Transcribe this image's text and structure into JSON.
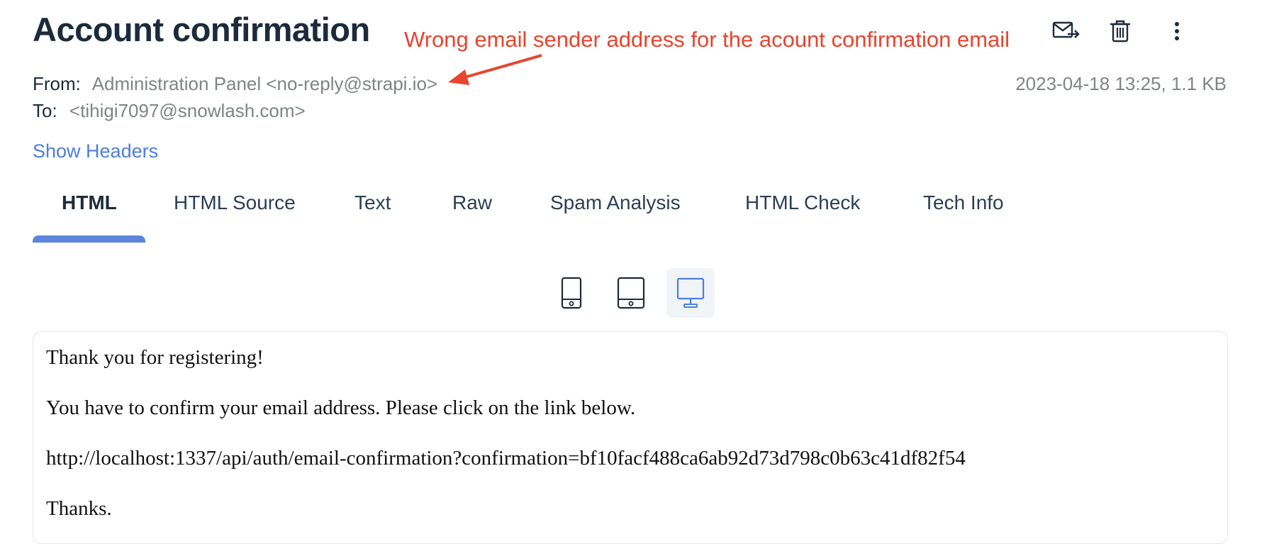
{
  "message": {
    "title": "Account confirmation",
    "from_label": "From:",
    "from_value": "Administration Panel <no-reply@strapi.io>",
    "to_label": "To:",
    "to_value": "<tihigi7097@snowlash.com>",
    "date_size": "2023-04-18 13:25, 1.1 KB",
    "show_headers": "Show Headers"
  },
  "annotation": {
    "text": "Wrong email sender address for the acount confirmation email",
    "color": "#e8442e"
  },
  "toolbar": {
    "icons": [
      "forward-mail-icon",
      "trash-icon",
      "more-vertical-icon"
    ]
  },
  "tabs": [
    {
      "label": "HTML",
      "active": true
    },
    {
      "label": "HTML Source"
    },
    {
      "label": "Text"
    },
    {
      "label": "Raw"
    },
    {
      "label": "Spam Analysis"
    },
    {
      "label": "HTML Check"
    },
    {
      "label": "Tech Info"
    }
  ],
  "devices": {
    "icons": [
      "phone-icon",
      "tablet-icon",
      "desktop-icon"
    ],
    "selected": "desktop"
  },
  "body": {
    "line1": "Thank you for registering!",
    "line2": "You have to confirm your email address. Please click on the link below.",
    "line3": "http://localhost:1337/api/auth/email-confirmation?confirmation=bf10facf488ca6ab92d73d798c0b63c41df82f54",
    "line4": "Thanks."
  },
  "colors": {
    "accent": "#5b86d9",
    "link": "#4a7fdc",
    "muted_text": "#7f8584",
    "heading": "#1c2b3c"
  }
}
